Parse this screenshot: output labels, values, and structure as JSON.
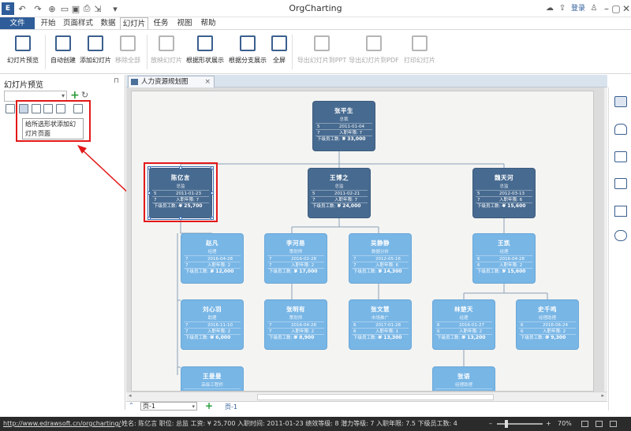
{
  "window": {
    "title": "OrgCharting",
    "login_label": "登录"
  },
  "tabs": [
    {
      "label": "文件"
    },
    {
      "label": "开始"
    },
    {
      "label": "页面样式"
    },
    {
      "label": "数据"
    },
    {
      "label": "幻灯片"
    },
    {
      "label": "任务"
    },
    {
      "label": "视图"
    },
    {
      "label": "帮助"
    }
  ],
  "ribbon": [
    {
      "label": "幻灯片预览",
      "enabled": true
    },
    {
      "label": "自动创建",
      "enabled": true
    },
    {
      "label": "添加幻灯片",
      "enabled": true
    },
    {
      "label": "移除全部",
      "enabled": false
    },
    {
      "label": "放映幻灯片",
      "enabled": false
    },
    {
      "label": "根据形状展示",
      "enabled": true
    },
    {
      "label": "根据分支展示",
      "enabled": true
    },
    {
      "label": "全屏",
      "enabled": true
    },
    {
      "label": "导出幻灯片到PPT",
      "enabled": false
    },
    {
      "label": "导出幻灯片到PDF",
      "enabled": false
    },
    {
      "label": "打印幻灯片",
      "enabled": false
    }
  ],
  "left_panel": {
    "title": "幻灯片预览",
    "tooltip": "给所选形状添加幻灯片页面"
  },
  "document": {
    "tab_label": "人力资源规划图",
    "close_icon": "×"
  },
  "chart": {
    "nodes": [
      {
        "id": "n1",
        "name": "张平生",
        "title": "总裁",
        "r1a": "5",
        "r1b": "2011-01-04",
        "r2a": "7",
        "r2b": "入职年限: 7",
        "r3a": "下级员工数: 7",
        "r3b": "¥ 33,000",
        "style": "dark"
      },
      {
        "id": "n2",
        "name": "陈亿言",
        "title": "总监",
        "r1a": "5",
        "r1b": "2011-01-23",
        "r2a": "7",
        "r2b": "入职年限: 7",
        "r3a": "下级员工数: 4",
        "r3b": "¥ 25,700",
        "style": "dark",
        "selected": true
      },
      {
        "id": "n3",
        "name": "王博之",
        "title": "总监",
        "r1a": "5",
        "r1b": "2011-02-21",
        "r2a": "7",
        "r2b": "入职年限: 7",
        "r3a": "下级员工数: 3",
        "r3b": "¥ 24,000",
        "style": "dark"
      },
      {
        "id": "n4",
        "name": "魏天河",
        "title": "总监",
        "r1a": "5",
        "r1b": "2012-03-13",
        "r2a": "7",
        "r2b": "入职年限: 6",
        "r3a": "下级员工数: 4",
        "r3b": "¥ 15,600",
        "style": "dark"
      },
      {
        "id": "n5",
        "name": "赵凡",
        "title": "经理",
        "r1a": "7",
        "r1b": "2016-04-28",
        "r2a": "7",
        "r2b": "入职年限: 2",
        "r3a": "下级员工数: 2",
        "r3b": "¥ 12,000",
        "style": "light"
      },
      {
        "id": "n6",
        "name": "李河易",
        "title": "策划师",
        "r1a": "7",
        "r1b": "2016-02-28",
        "r2a": "7",
        "r2b": "入职年限: 2",
        "r3a": "下级员工数: 1",
        "r3b": "¥ 17,000",
        "style": "light"
      },
      {
        "id": "n7",
        "name": "吴静静",
        "title": "数据分析",
        "r1a": "7",
        "r1b": "2012-05-16",
        "r2a": "7",
        "r2b": "入职年限: 6",
        "r3a": "下级员工数: 1",
        "r3b": "¥ 14,300",
        "style": "light"
      },
      {
        "id": "n8",
        "name": "王凯",
        "title": "经理",
        "r1a": "6",
        "r1b": "2016-04-28",
        "r2a": "6",
        "r2b": "入职年限: 2",
        "r3a": "下级员工数: 3",
        "r3b": "¥ 15,600",
        "style": "light"
      },
      {
        "id": "n9",
        "name": "刘心羽",
        "title": "助理",
        "r1a": "7",
        "r1b": "2016-11-10",
        "r2a": "7",
        "r2b": "入职年限: 2",
        "r3a": "下级员工数: 0",
        "r3b": "¥ 6,000",
        "style": "light"
      },
      {
        "id": "n10",
        "name": "张明有",
        "title": "策划师",
        "r1a": "7",
        "r1b": "2016-04-28",
        "r2a": "7",
        "r2b": "入职年限: 2",
        "r3a": "下级员工数: 0",
        "r3b": "¥ 8,900",
        "style": "light"
      },
      {
        "id": "n11",
        "name": "张文慧",
        "title": "市场推广",
        "r1a": "6",
        "r1b": "2017-01-28",
        "r2a": "6",
        "r2b": "入职年限: 1",
        "r3a": "下级员工数: 0",
        "r3b": "¥ 13,300",
        "style": "light"
      },
      {
        "id": "n12",
        "name": "林楚天",
        "title": "经理",
        "r1a": "6",
        "r1b": "2016-01-27",
        "r2a": "6",
        "r2b": "入职年限: 2",
        "r3a": "下级员工数: 0",
        "r3b": "¥ 13,200",
        "style": "light"
      },
      {
        "id": "n13",
        "name": "史千鸣",
        "title": "经理助理",
        "r1a": "6",
        "r1b": "2016-06-24",
        "r2a": "6",
        "r2b": "入职年限: 2",
        "r3a": "下级员工数: 0",
        "r3b": "¥ 9,300",
        "style": "light"
      },
      {
        "id": "n14",
        "name": "王曼曼",
        "title": "高级工程师",
        "r1a": "",
        "r1b": "",
        "r2a": "",
        "r2b": "",
        "r3a": "",
        "r3b": "",
        "style": "light"
      },
      {
        "id": "n15",
        "name": "张语",
        "title": "经理助理",
        "r1a": "",
        "r1b": "",
        "r2a": "",
        "r2b": "",
        "r3a": "",
        "r3b": "",
        "style": "light"
      }
    ]
  },
  "page_bar": {
    "page_select": "页-1",
    "page_tab": "页-1"
  },
  "status_bar": {
    "url": "http://www.edrawsoft.cn/orgcharting/",
    "info": "姓名: 陈亿言  职位: 总监  工资: ¥ 25,700  入职时间: 2011-01-23  绩效等级: 8  潜力等级: 7  入职年限: 7.5  下级员工数: 4",
    "zoom": "70%"
  }
}
